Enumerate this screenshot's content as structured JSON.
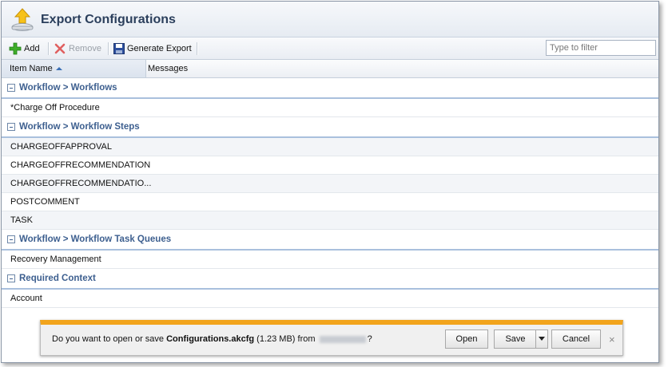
{
  "window": {
    "title": "Export Configurations"
  },
  "toolbar": {
    "add_label": "Add",
    "remove_label": "Remove",
    "generate_label": "Generate Export",
    "filter_placeholder": "Type to filter",
    "filter_value": ""
  },
  "columns": {
    "item_name": "Item Name",
    "messages": "Messages"
  },
  "groups": [
    {
      "label": "Workflow > Workflows",
      "items": [
        "*Charge Off Procedure"
      ]
    },
    {
      "label": "Workflow > Workflow Steps",
      "items": [
        "CHARGEOFFAPPROVAL",
        "CHARGEOFFRECOMMENDATION",
        "CHARGEOFFRECOMMENDATIO...",
        "POSTCOMMENT",
        "TASK"
      ]
    },
    {
      "label": "Workflow > Workflow Task Queues",
      "items": [
        "Recovery Management"
      ]
    },
    {
      "label": "Required Context",
      "items": [
        "Account"
      ]
    }
  ],
  "download": {
    "prefix": "Do you want to open or save ",
    "filename": "Configurations.akcfg",
    "size": " (1.23 MB) from ",
    "suffix": "?",
    "open_label": "Open",
    "save_label": "Save",
    "cancel_label": "Cancel",
    "close_label": "×",
    "accent": "#f2a41c"
  },
  "icons": {
    "title": "export-upload-icon",
    "add": "green-plus-icon",
    "remove": "red-x-icon",
    "generate": "floppy-disk-icon"
  }
}
